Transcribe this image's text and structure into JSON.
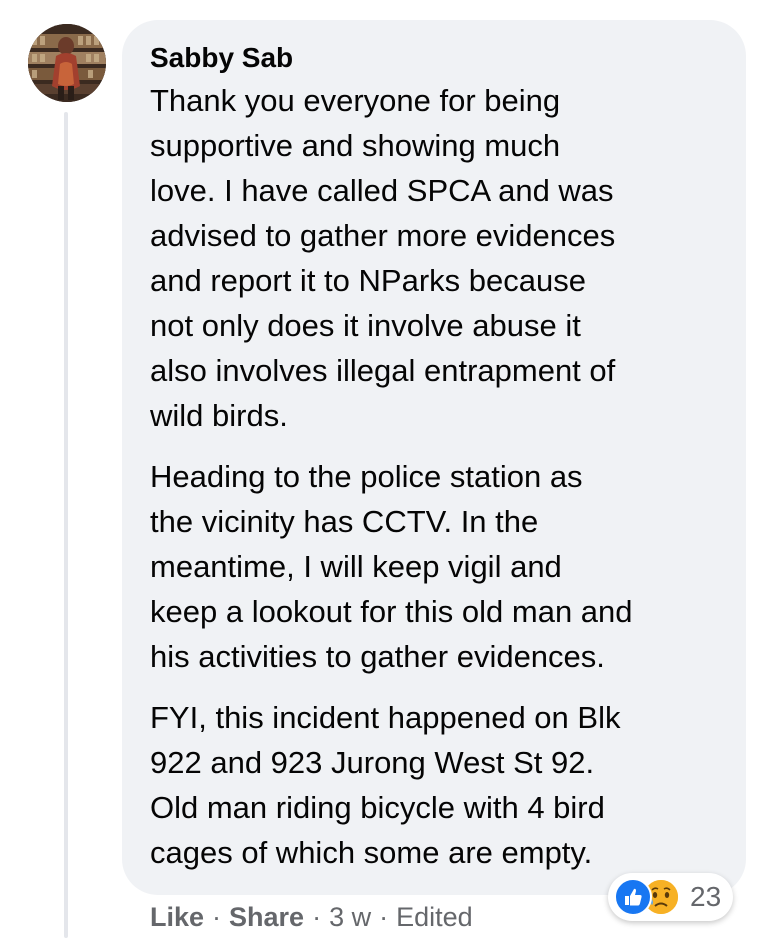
{
  "comment": {
    "author": "Sabby Sab",
    "paragraphs": [
      "Thank you everyone for being\nsupportive and showing much\nlove. I have called SPCA and was\nadvised to gather more evidences\nand report it to NParks because\nnot only does it involve abuse it\nalso involves illegal entrapment of\nwild birds.",
      "Heading to the police station as\nthe vicinity has CCTV. In the\nmeantime, I will keep vigil and\nkeep a lookout for this old man and\nhis activities to gather evidences.",
      "FYI, this incident happened on Blk\n922 and 923 Jurong West St 92.\nOld man riding bicycle with 4 bird\ncages of which some are empty."
    ],
    "reactions": {
      "icons": [
        "like-icon",
        "sad-icon"
      ],
      "count": "23"
    }
  },
  "actions": {
    "like": "Like",
    "share": "Share",
    "separator": "·",
    "time": "3 w",
    "edited": "Edited"
  },
  "colors": {
    "bubble": "#f0f2f5",
    "secondary_text": "#65676b",
    "like_blue": "#1877f2",
    "sad_yellow": "#f7b125"
  }
}
